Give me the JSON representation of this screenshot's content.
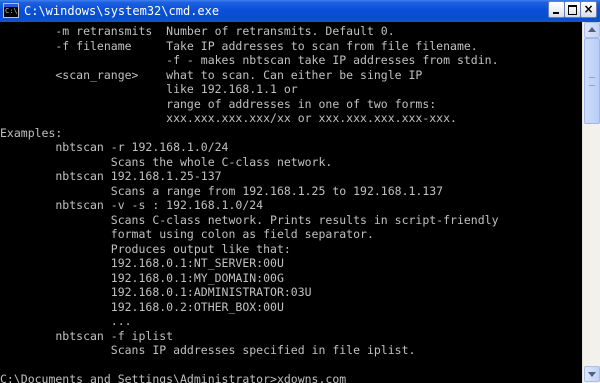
{
  "window": {
    "title": "C:\\windows\\system32\\cmd.exe",
    "icon": "cmd-icon",
    "controls": {
      "minimize": "minimize-icon",
      "maximize": "maximize-icon",
      "close_label": "×"
    }
  },
  "console": {
    "text_color": "#c0c0c0",
    "background": "#000000",
    "lines": [
      "        -m retransmits  Number of retransmits. Default 0.",
      "        -f filename     Take IP addresses to scan from file filename.",
      "                        -f - makes nbtscan take IP addresses from stdin.",
      "        <scan_range>    what to scan. Can either be single IP",
      "                        like 192.168.1.1 or",
      "                        range of addresses in one of two forms:",
      "                        xxx.xxx.xxx.xxx/xx or xxx.xxx.xxx.xxx-xxx.",
      "Examples:",
      "        nbtscan -r 192.168.1.0/24",
      "                Scans the whole C-class network.",
      "        nbtscan 192.168.1.25-137",
      "                Scans a range from 192.168.1.25 to 192.168.1.137",
      "        nbtscan -v -s : 192.168.1.0/24",
      "                Scans C-class network. Prints results in script-friendly",
      "                format using colon as field separator.",
      "                Produces output like that:",
      "                192.168.0.1:NT_SERVER:00U",
      "                192.168.0.1:MY_DOMAIN:00G",
      "                192.168.0.1:ADMINISTRATOR:03U",
      "                192.168.0.2:OTHER_BOX:00U",
      "                ...",
      "        nbtscan -f iplist",
      "                Scans IP addresses specified in file iplist.",
      "",
      "C:\\Documents and Settings\\Administrator>xdowns.com"
    ]
  },
  "scrollbar": {
    "up_icon": "scroll-up-arrow-icon",
    "down_icon": "scroll-down-arrow-icon"
  }
}
